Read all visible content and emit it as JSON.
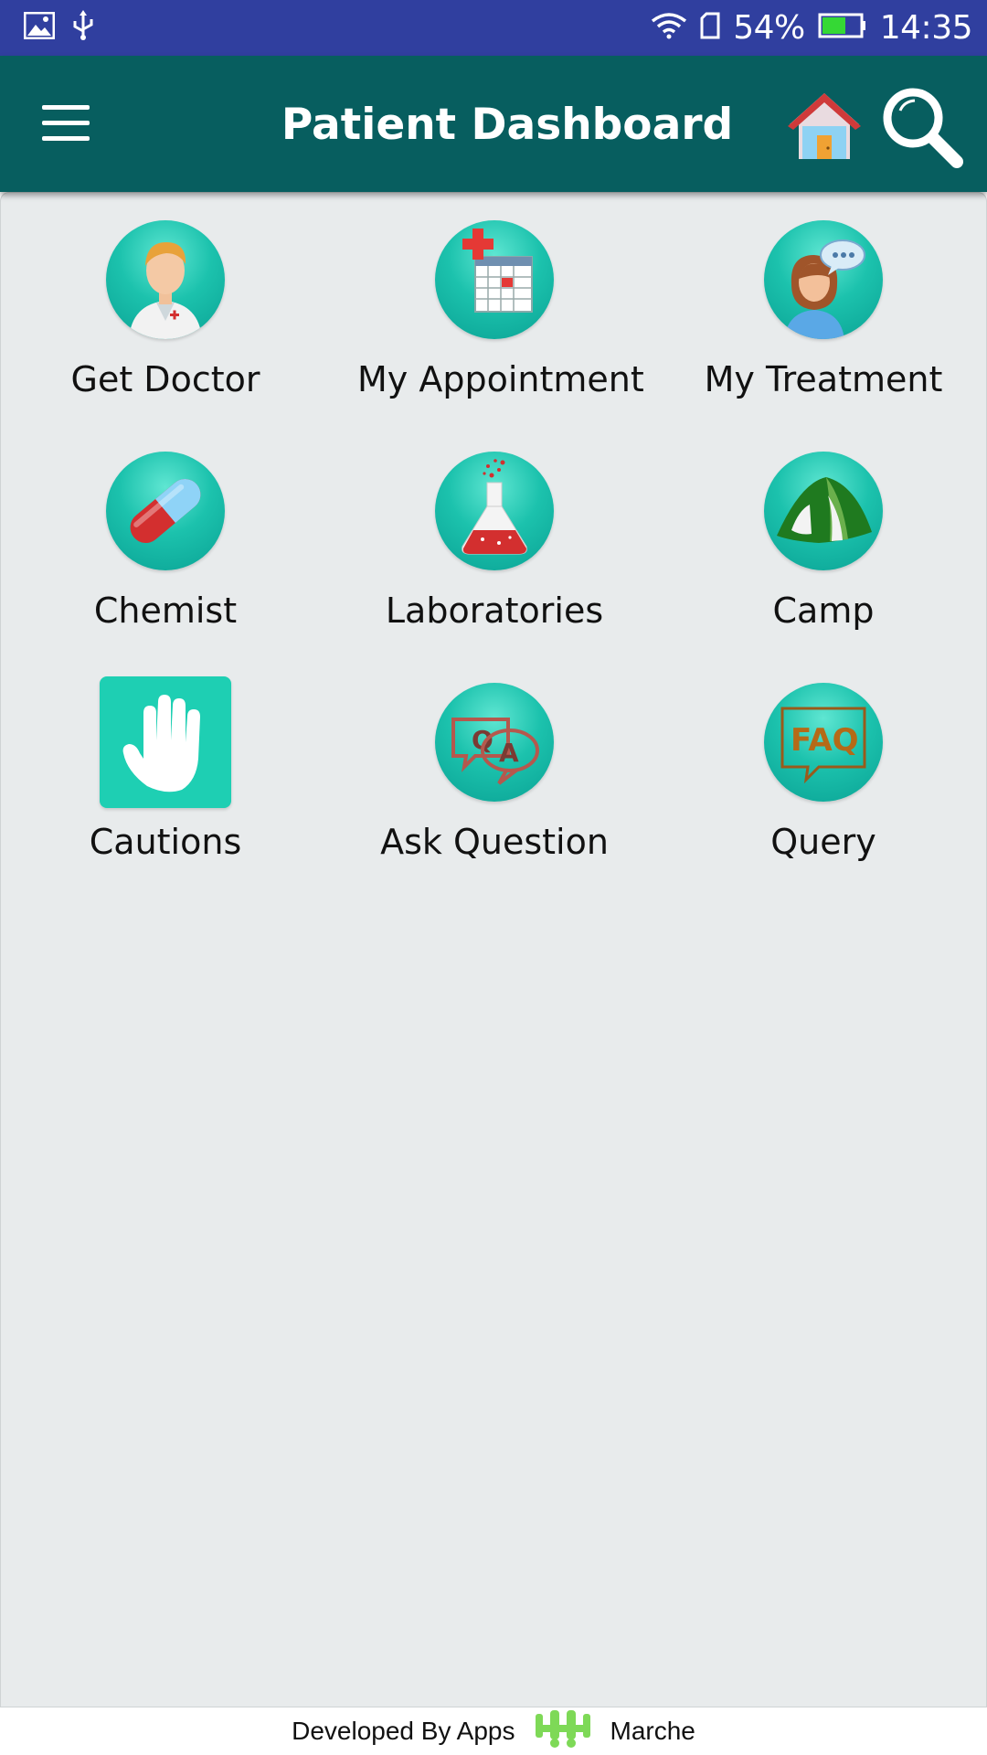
{
  "status_bar": {
    "battery": "54%",
    "time": "14:35",
    "icons": [
      "image-icon",
      "usb-icon",
      "wifi-icon",
      "sim-icon",
      "battery-icon"
    ]
  },
  "app_bar": {
    "title": "Patient Dashboard",
    "icons": [
      "menu-icon",
      "home-icon",
      "search-icon"
    ]
  },
  "dashboard": {
    "items": [
      {
        "label": "Get Doctor",
        "icon": "doctor-icon"
      },
      {
        "label": "My Appointment",
        "icon": "calendar-icon"
      },
      {
        "label": "My Treatment",
        "icon": "chat-person-icon"
      },
      {
        "label": "Chemist",
        "icon": "pill-icon"
      },
      {
        "label": "Laboratories",
        "icon": "flask-icon"
      },
      {
        "label": "Camp",
        "icon": "tent-icon"
      },
      {
        "label": "Cautions",
        "icon": "hand-icon"
      },
      {
        "label": "Ask Question",
        "icon": "qa-icon"
      },
      {
        "label": "Query",
        "icon": "faq-icon"
      }
    ]
  },
  "footer": {
    "left": "Developed By Apps",
    "right": "Marche",
    "logo_icon": "apps-marche-logo-icon"
  },
  "colors": {
    "status_bar": "#303f9f",
    "app_bar": "#075e5f",
    "content_bg": "#e8ebec",
    "icon_teal": "#1cc2ad"
  }
}
